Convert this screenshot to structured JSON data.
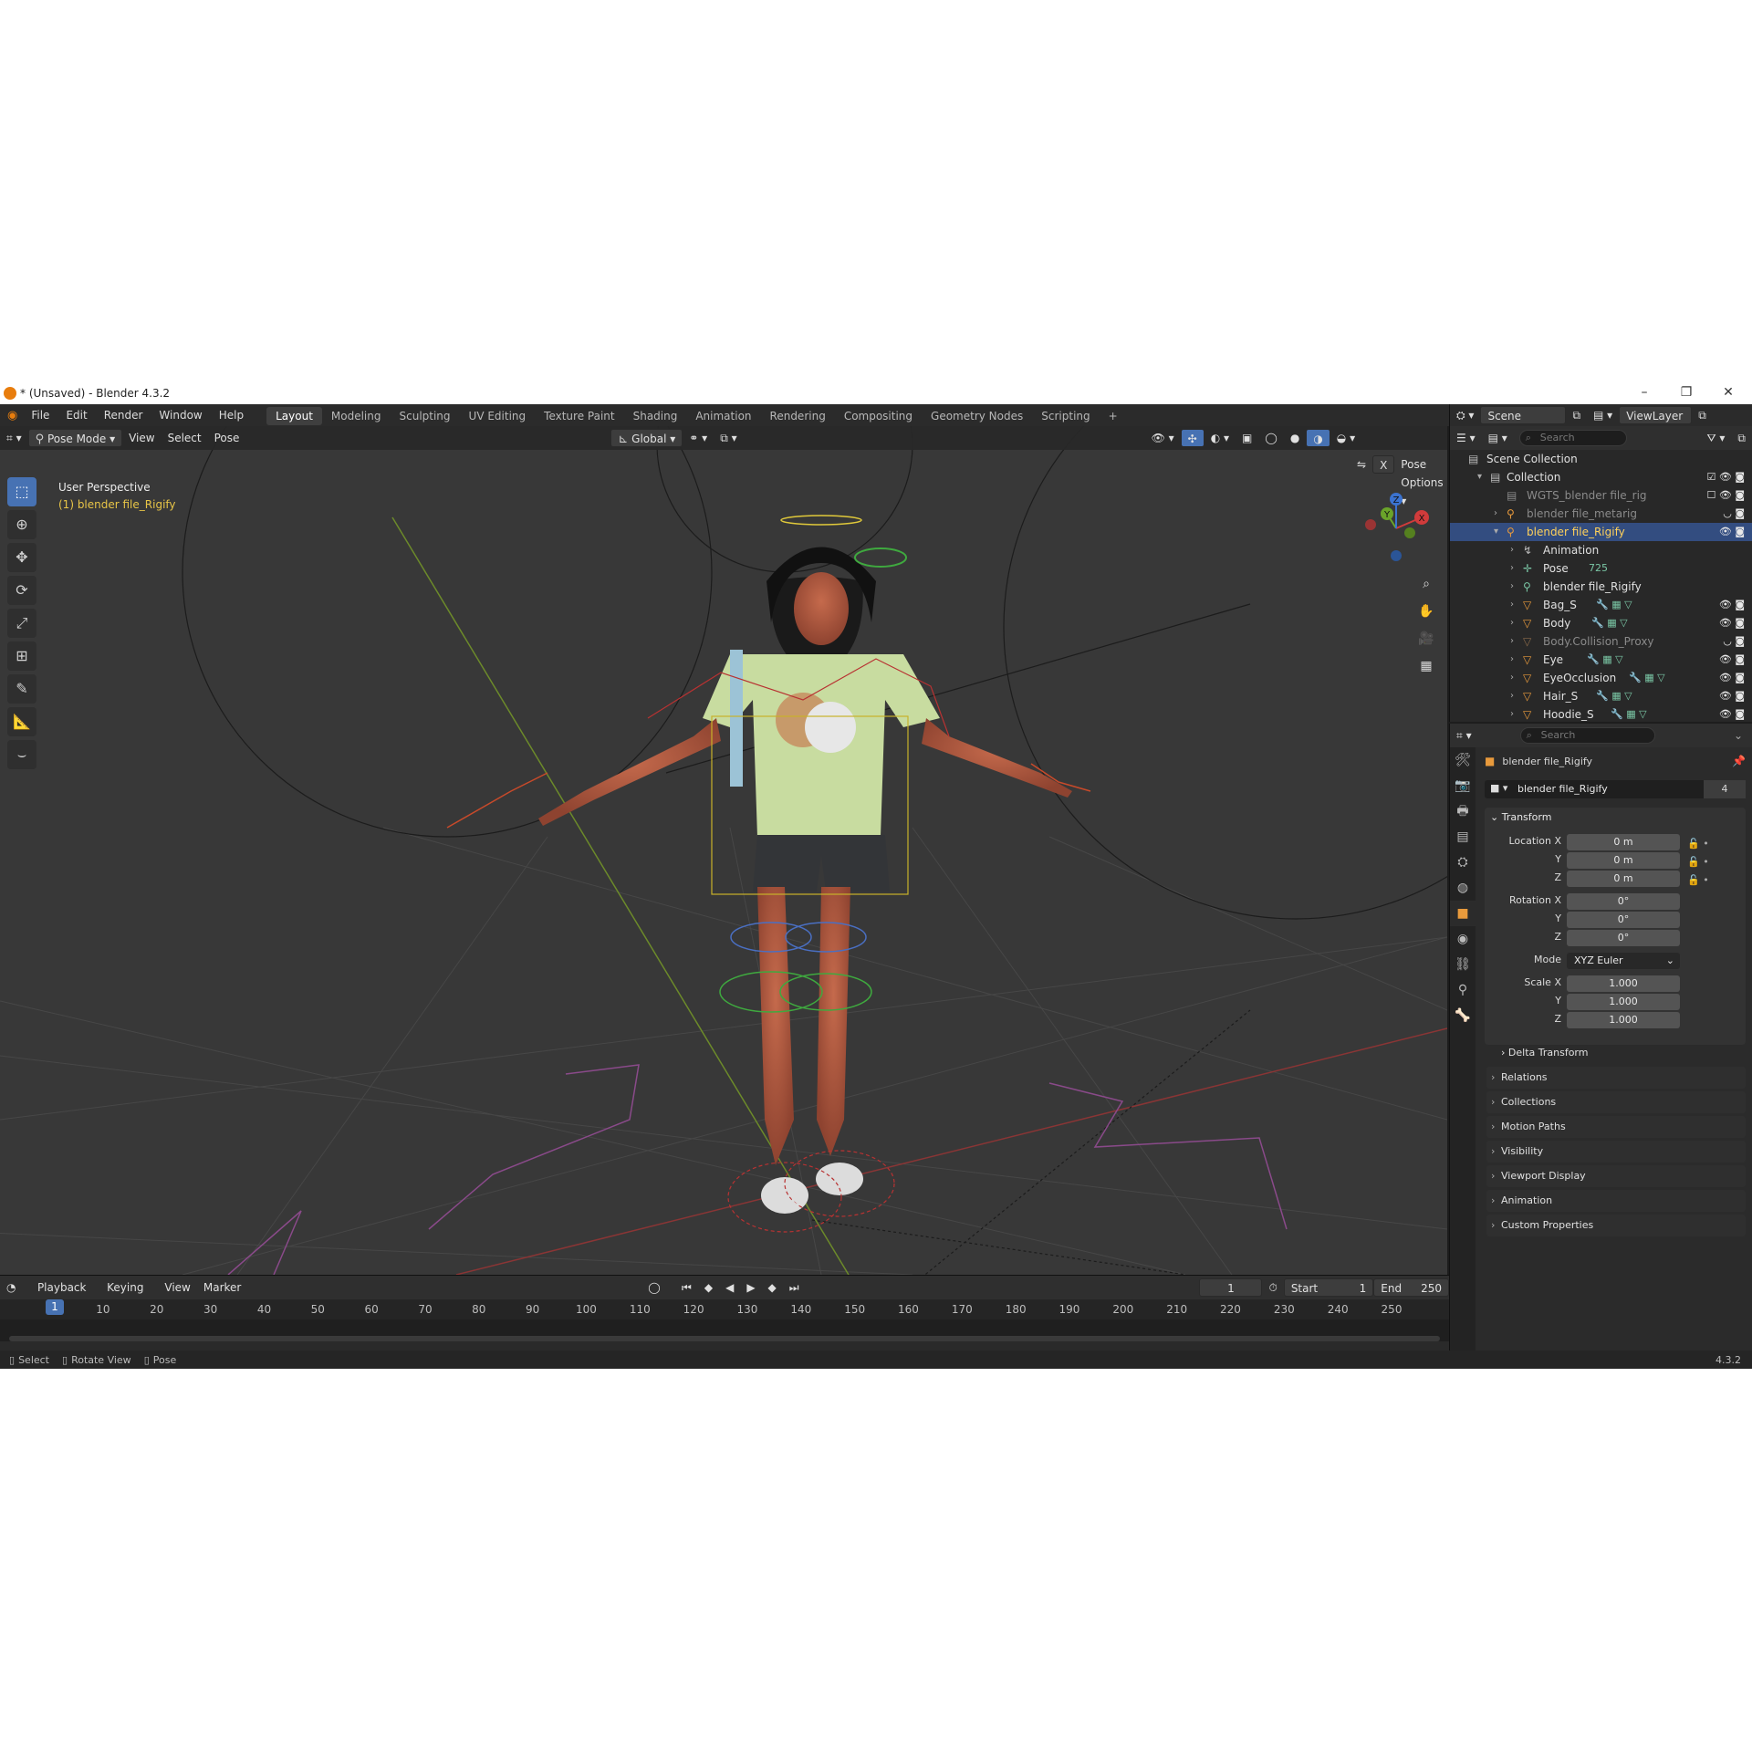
{
  "window": {
    "title": "* (Unsaved) - Blender 4.3.2"
  },
  "menu": [
    "File",
    "Edit",
    "Render",
    "Window",
    "Help"
  ],
  "workspaces": [
    "Layout",
    "Modeling",
    "Sculpting",
    "UV Editing",
    "Texture Paint",
    "Shading",
    "Animation",
    "Rendering",
    "Compositing",
    "Geometry Nodes",
    "Scripting"
  ],
  "active_workspace": "Layout",
  "scene": {
    "name": "Scene",
    "view_layer": "ViewLayer"
  },
  "viewport": {
    "mode": "Pose Mode",
    "menus": [
      "View",
      "Select",
      "Pose"
    ],
    "orientation": "Global",
    "perspective": "User Perspective",
    "active_object": "(1) blender file_Rigify",
    "pose_options": "Pose Options",
    "x_label": "X",
    "gizmo_axes": {
      "x": "X",
      "y": "Y",
      "z": "Z"
    }
  },
  "timeline": {
    "menus": [
      "Playback",
      "Keying",
      "View",
      "Marker"
    ],
    "current_frame": "1",
    "start_label": "Start",
    "start": "1",
    "end_label": "End",
    "end": "250",
    "ticks": [
      "1",
      "10",
      "20",
      "30",
      "40",
      "50",
      "60",
      "70",
      "80",
      "90",
      "100",
      "110",
      "120",
      "130",
      "140",
      "150",
      "160",
      "170",
      "180",
      "190",
      "200",
      "210",
      "220",
      "230",
      "240",
      "250"
    ]
  },
  "statusbar": {
    "select": "Select",
    "rotate": "Rotate View",
    "pose": "Pose",
    "version": "4.3.2"
  },
  "outliner": {
    "search_placeholder": "Search",
    "rows": [
      {
        "name": "Scene Collection",
        "icon": "scene-collection-icon"
      },
      {
        "name": "Collection",
        "icon": "collection-icon"
      },
      {
        "name": "WGTS_blender file_rig",
        "icon": "collection-icon"
      },
      {
        "name": "blender file_metarig",
        "icon": "armature-icon"
      },
      {
        "name": "blender file_Rigify",
        "icon": "armature-icon"
      },
      {
        "name": "Animation",
        "icon": "action-icon"
      },
      {
        "name": "Pose",
        "icon": "pose-icon",
        "badge": "725"
      },
      {
        "name": "blender file_Rigify",
        "icon": "armature-data-icon"
      },
      {
        "name": "Bag_S",
        "icon": "mesh-icon"
      },
      {
        "name": "Body",
        "icon": "mesh-icon"
      },
      {
        "name": "Body.Collision_Proxy",
        "icon": "mesh-icon"
      },
      {
        "name": "Eye",
        "icon": "mesh-icon"
      },
      {
        "name": "EyeOcclusion",
        "icon": "mesh-icon"
      },
      {
        "name": "Hair_S",
        "icon": "mesh-icon"
      },
      {
        "name": "Hoodie_S",
        "icon": "mesh-icon"
      }
    ]
  },
  "properties": {
    "search_placeholder": "Search",
    "object_name": "blender file_Rigify",
    "datablock_name": "blender file_Rigify",
    "users": "4",
    "transform_title": "Transform",
    "location_label": "Location X",
    "rotation_label": "Rotation X",
    "scale_label": "Scale X",
    "y": "Y",
    "z": "Z",
    "mode_label": "Mode",
    "location": [
      "0 m",
      "0 m",
      "0 m"
    ],
    "rotation": [
      "0°",
      "0°",
      "0°"
    ],
    "mode": "XYZ Euler",
    "scale": [
      "1.000",
      "1.000",
      "1.000"
    ],
    "delta": "Delta Transform",
    "panels": [
      "Relations",
      "Collections",
      "Motion Paths",
      "Visibility",
      "Viewport Display",
      "Animation",
      "Custom Properties"
    ]
  }
}
